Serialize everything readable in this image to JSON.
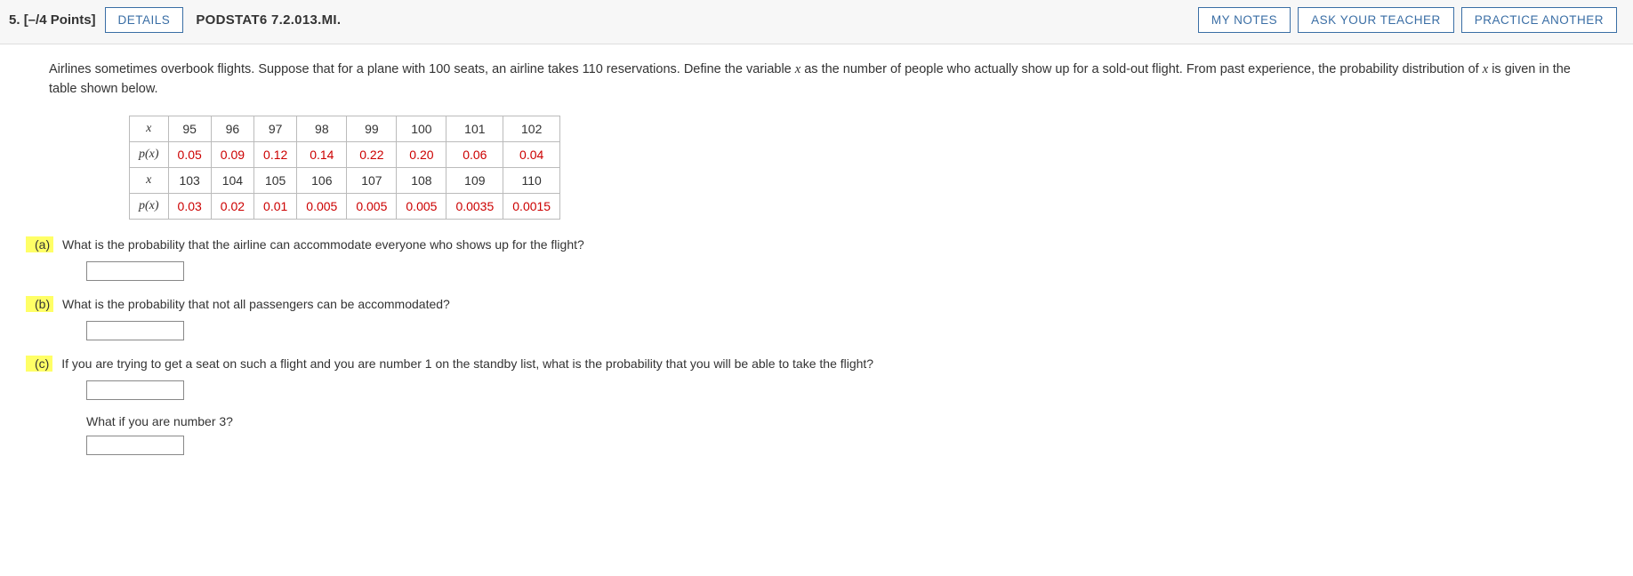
{
  "header": {
    "number": "5.",
    "points": "[–/4 Points]",
    "details_btn": "DETAILS",
    "source": "PODSTAT6 7.2.013.MI.",
    "my_notes": "MY NOTES",
    "ask_teacher": "ASK YOUR TEACHER",
    "practice_another": "PRACTICE ANOTHER"
  },
  "problem": {
    "text_before_x": "Airlines sometimes overbook flights. Suppose that for a plane with 100 seats, an airline takes 110 reservations. Define the variable ",
    "var": "x",
    "text_after_x": " as the number of people who actually show up for a sold-out flight. From past experience, the probability distribution of ",
    "var2": "x",
    "text_end": " is given in the table shown below."
  },
  "table": {
    "x_label": "x",
    "px_label": "p(x)",
    "row1_x": [
      "95",
      "96",
      "97",
      "98",
      "99",
      "100",
      "101",
      "102"
    ],
    "row1_p": [
      "0.05",
      "0.09",
      "0.12",
      "0.14",
      "0.22",
      "0.20",
      "0.06",
      "0.04"
    ],
    "row2_x": [
      "103",
      "104",
      "105",
      "106",
      "107",
      "108",
      "109",
      "110"
    ],
    "row2_p": [
      "0.03",
      "0.02",
      "0.01",
      "0.005",
      "0.005",
      "0.005",
      "0.0035",
      "0.0015"
    ]
  },
  "parts": {
    "a": {
      "label": "(a)",
      "text": "What is the probability that the airline can accommodate everyone who shows up for the flight?"
    },
    "b": {
      "label": "(b)",
      "text": "What is the probability that not all passengers can be accommodated?"
    },
    "c": {
      "label": "(c)",
      "text": "If you are trying to get a seat on such a flight and you are number 1 on the standby list, what is the probability that you will be able to take the flight?",
      "sub": "What if you are number 3?"
    }
  },
  "chart_data": {
    "type": "table",
    "title": "Probability distribution of x (number who show up)",
    "x": [
      95,
      96,
      97,
      98,
      99,
      100,
      101,
      102,
      103,
      104,
      105,
      106,
      107,
      108,
      109,
      110
    ],
    "p": [
      0.05,
      0.09,
      0.12,
      0.14,
      0.22,
      0.2,
      0.06,
      0.04,
      0.03,
      0.02,
      0.01,
      0.005,
      0.005,
      0.005,
      0.0035,
      0.0015
    ]
  }
}
